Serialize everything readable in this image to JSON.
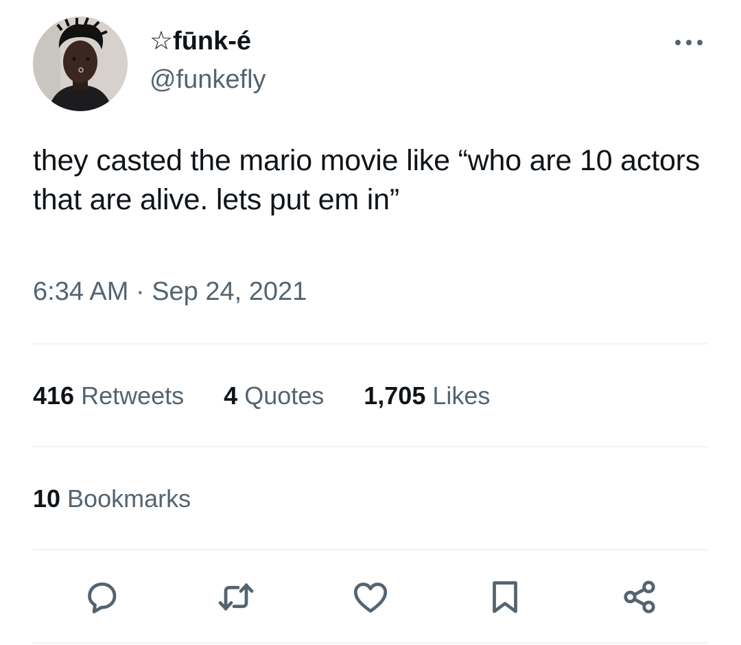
{
  "user": {
    "display_name": "☆fūnk-é",
    "handle": "@funkefly"
  },
  "tweet": {
    "text": "they casted the mario movie like “who are 10 actors that are alive. lets put em in”",
    "timestamp": "6:34 AM · Sep 24, 2021"
  },
  "stats": {
    "retweets_count": "416",
    "retweets_label": "Retweets",
    "quotes_count": "4",
    "quotes_label": "Quotes",
    "likes_count": "1,705",
    "likes_label": "Likes",
    "bookmarks_count": "10",
    "bookmarks_label": "Bookmarks"
  },
  "actions": {
    "icons": [
      "reply-icon",
      "retweet-icon",
      "like-icon",
      "bookmark-icon",
      "share-icon"
    ]
  },
  "colors": {
    "text_primary": "#0f1419",
    "text_secondary": "#536471",
    "divider": "#eff3f4",
    "icon": "#536471"
  }
}
